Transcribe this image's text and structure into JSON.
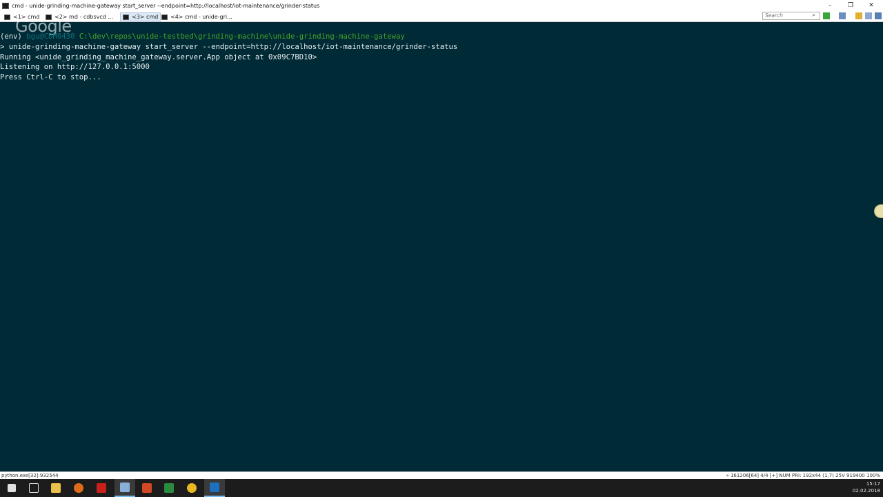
{
  "window": {
    "title": "cmd - unide-grinding-machine-gateway  start_server --endpoint=http://localhost/iot-maintenance/grinder-status"
  },
  "tabs": [
    {
      "label": "<1>  cmd"
    },
    {
      "label": "<2>  md - cdbsvcd ..."
    },
    {
      "label": "<3>  cmd"
    },
    {
      "label": "<4>  cmd - unide-gri..."
    }
  ],
  "search": {
    "placeholder": "Search"
  },
  "watermark": "Google",
  "console": {
    "prompt": {
      "env": "(env) ",
      "user": "bgu@CDM0430 ",
      "path": "C:\\dev\\repos\\unide-testbed\\grinding-machine\\unide-grinding-machine-gateway"
    },
    "lines": [
      "> unide-grinding-machine-gateway start_server --endpoint=http://localhost/iot-maintenance/grinder-status",
      "Running <unide_grinding_machine_gateway.server.App object at 0x09C7BD10>",
      "Listening on http://127.0.0.1:5000",
      "Press Ctrl-C to stop..."
    ]
  },
  "statusbar": {
    "left": "python.exe[32]:932544",
    "right": "« 161206[64]   4/4   [+] NUM   PRI:   192x44    (1,7) 25V      919400  100%"
  },
  "clock": {
    "time": "15:17",
    "date": "02.02.2018"
  },
  "colors": {
    "console_bg": "#002b36",
    "prompt_path": "#46a329",
    "prompt_user": "#0d6f78"
  },
  "taskbar": {
    "icons": [
      "windows-start-icon",
      "task-view-icon",
      "file-explorer-icon",
      "firefox-icon",
      "acrobat-icon",
      "console-icon",
      "powerpoint-icon",
      "excel-icon",
      "chrome-icon",
      "outlook-icon"
    ]
  }
}
